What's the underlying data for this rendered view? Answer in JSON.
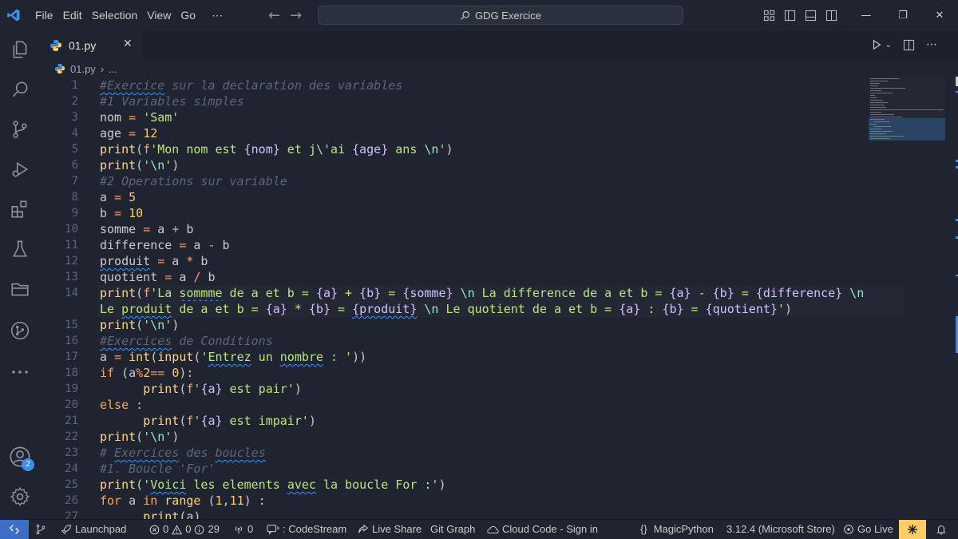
{
  "titlebar": {
    "menu": [
      "File",
      "Edit",
      "Selection",
      "View",
      "Go",
      "⋯"
    ],
    "search": "GDG Exercice"
  },
  "activity": {
    "accounts_badge": "2"
  },
  "tabs": [
    {
      "label": "01.py"
    }
  ],
  "breadcrumb": {
    "file": "01.py",
    "rest": "..."
  },
  "editor": {
    "lines": [
      {
        "n": "1",
        "tokens": [
          [
            "c",
            "#Exercice",
            "sq"
          ],
          [
            "c",
            " sur la declaration des variables"
          ]
        ]
      },
      {
        "n": "2",
        "tokens": [
          [
            "c",
            "#1 Variables simples"
          ]
        ]
      },
      {
        "n": "3",
        "tokens": [
          [
            "v",
            "nom "
          ],
          [
            "o",
            "="
          ],
          [
            "v",
            " "
          ],
          [
            "s",
            "'Sam'"
          ]
        ]
      },
      {
        "n": "4",
        "tokens": [
          [
            "v",
            "age "
          ],
          [
            "o",
            "="
          ],
          [
            "v",
            " "
          ],
          [
            "n",
            "12"
          ]
        ]
      },
      {
        "n": "5",
        "tokens": [
          [
            "f",
            "print"
          ],
          [
            "v",
            "("
          ],
          [
            "k",
            "f"
          ],
          [
            "s",
            "'Mon nom est "
          ],
          [
            "b",
            "{nom}"
          ],
          [
            "s",
            " et j"
          ],
          [
            "e",
            "\\'"
          ],
          [
            "s",
            "ai "
          ],
          [
            "b",
            "{age}"
          ],
          [
            "s",
            " ans "
          ],
          [
            "e",
            "\\n"
          ],
          [
            "s",
            "'"
          ],
          [
            "v",
            ")"
          ]
        ]
      },
      {
        "n": "6",
        "tokens": [
          [
            "f",
            "print"
          ],
          [
            "v",
            "("
          ],
          [
            "s",
            "'"
          ],
          [
            "e",
            "\\n"
          ],
          [
            "s",
            "'"
          ],
          [
            "v",
            ")"
          ]
        ]
      },
      {
        "n": "7",
        "tokens": [
          [
            "c",
            "#2 Operations sur variable"
          ]
        ]
      },
      {
        "n": "8",
        "tokens": [
          [
            "v",
            "a "
          ],
          [
            "o",
            "="
          ],
          [
            "v",
            " "
          ],
          [
            "n",
            "5"
          ]
        ]
      },
      {
        "n": "9",
        "tokens": [
          [
            "v",
            "b "
          ],
          [
            "o",
            "="
          ],
          [
            "v",
            " "
          ],
          [
            "n",
            "10"
          ]
        ]
      },
      {
        "n": "10",
        "tokens": [
          [
            "v",
            "somme "
          ],
          [
            "o",
            "="
          ],
          [
            "v",
            " a "
          ],
          [
            "o",
            "+"
          ],
          [
            "v",
            " b"
          ]
        ]
      },
      {
        "n": "11",
        "tokens": [
          [
            "v",
            "difference "
          ],
          [
            "o",
            "="
          ],
          [
            "v",
            " a "
          ],
          [
            "o",
            "-"
          ],
          [
            "v",
            " b"
          ]
        ]
      },
      {
        "n": "12",
        "tokens": [
          [
            "v",
            "produit",
            "sq"
          ],
          [
            "v",
            " "
          ],
          [
            "o",
            "="
          ],
          [
            "v",
            " a "
          ],
          [
            "o",
            "*"
          ],
          [
            "v",
            " b"
          ]
        ]
      },
      {
        "n": "13",
        "tokens": [
          [
            "v",
            "quotient "
          ],
          [
            "o",
            "="
          ],
          [
            "v",
            " a "
          ],
          [
            "o",
            "/"
          ],
          [
            "v",
            " b"
          ]
        ]
      },
      {
        "n": "14",
        "hl": true,
        "tokens": [
          [
            "f",
            "print"
          ],
          [
            "v",
            "("
          ],
          [
            "k",
            "f"
          ],
          [
            "s",
            "'La "
          ],
          [
            "s",
            "sommme",
            "sq"
          ],
          [
            "s",
            " de a et b = "
          ],
          [
            "b",
            "{a}"
          ],
          [
            "s",
            " + "
          ],
          [
            "b",
            "{b}"
          ],
          [
            "s",
            " = "
          ],
          [
            "b",
            "{somme}"
          ],
          [
            "s",
            " "
          ],
          [
            "e",
            "\\n"
          ],
          [
            "s",
            " La difference de a et b = "
          ],
          [
            "b",
            "{a}"
          ],
          [
            "s",
            " - "
          ],
          [
            "b",
            "{b}"
          ],
          [
            "s",
            " = "
          ],
          [
            "b",
            "{difference}"
          ],
          [
            "s",
            " "
          ],
          [
            "e",
            "\\n"
          ]
        ]
      },
      {
        "n": "",
        "hl": true,
        "tokens": [
          [
            "s",
            "Le "
          ],
          [
            "s",
            "produit",
            "sq"
          ],
          [
            "s",
            " de a et b = "
          ],
          [
            "b",
            "{a}"
          ],
          [
            "s",
            " * "
          ],
          [
            "b",
            "{b}"
          ],
          [
            "s",
            " = "
          ],
          [
            "b",
            "{produit}",
            "sq"
          ],
          [
            "s",
            " "
          ],
          [
            "e",
            "\\n"
          ],
          [
            "s",
            " Le quotient de a et b = "
          ],
          [
            "b",
            "{a}"
          ],
          [
            "s",
            " : "
          ],
          [
            "b",
            "{b}"
          ],
          [
            "s",
            " = "
          ],
          [
            "b",
            "{quotient}"
          ],
          [
            "s",
            "'"
          ],
          [
            "v",
            ")"
          ]
        ]
      },
      {
        "n": "15",
        "tokens": [
          [
            "f",
            "print"
          ],
          [
            "v",
            "("
          ],
          [
            "s",
            "'"
          ],
          [
            "e",
            "\\n"
          ],
          [
            "s",
            "'"
          ],
          [
            "v",
            ")"
          ]
        ]
      },
      {
        "n": "16",
        "tokens": [
          [
            "c",
            "#Exercices",
            "sq"
          ],
          [
            "c",
            " de Conditions"
          ]
        ]
      },
      {
        "n": "17",
        "tokens": [
          [
            "v",
            "a "
          ],
          [
            "o",
            "="
          ],
          [
            "v",
            " "
          ],
          [
            "f",
            "int"
          ],
          [
            "v",
            "("
          ],
          [
            "f",
            "input"
          ],
          [
            "v",
            "("
          ],
          [
            "s",
            "'"
          ],
          [
            "s",
            "Entrez",
            "sq"
          ],
          [
            "s",
            " un "
          ],
          [
            "s",
            "nombre",
            "sq"
          ],
          [
            "s",
            " : '"
          ],
          [
            "v",
            "))"
          ]
        ]
      },
      {
        "n": "18",
        "tokens": [
          [
            "k",
            "if"
          ],
          [
            "v",
            " (a"
          ],
          [
            "o",
            "%"
          ],
          [
            "n",
            "2"
          ],
          [
            "o",
            "=="
          ],
          [
            "v",
            " "
          ],
          [
            "n",
            "0"
          ],
          [
            "v",
            "):"
          ]
        ]
      },
      {
        "n": "19",
        "tokens": [
          [
            "v",
            "      "
          ],
          [
            "f",
            "print"
          ],
          [
            "v",
            "("
          ],
          [
            "k",
            "f"
          ],
          [
            "s",
            "'"
          ],
          [
            "b",
            "{a}"
          ],
          [
            "s",
            " est pair'"
          ],
          [
            "v",
            ")"
          ]
        ]
      },
      {
        "n": "20",
        "tokens": [
          [
            "k",
            "else"
          ],
          [
            "v",
            " :"
          ]
        ]
      },
      {
        "n": "21",
        "tokens": [
          [
            "v",
            "      "
          ],
          [
            "f",
            "print"
          ],
          [
            "v",
            "("
          ],
          [
            "k",
            "f"
          ],
          [
            "s",
            "'"
          ],
          [
            "b",
            "{a}"
          ],
          [
            "s",
            " est impair'"
          ],
          [
            "v",
            ")"
          ]
        ]
      },
      {
        "n": "22",
        "tokens": [
          [
            "f",
            "print"
          ],
          [
            "v",
            "("
          ],
          [
            "s",
            "'"
          ],
          [
            "e",
            "\\n"
          ],
          [
            "s",
            "'"
          ],
          [
            "v",
            ")"
          ]
        ]
      },
      {
        "n": "23",
        "tokens": [
          [
            "c",
            "# "
          ],
          [
            "c",
            "Exercices",
            "sq"
          ],
          [
            "c",
            " des "
          ],
          [
            "c",
            "boucles",
            "sq"
          ]
        ]
      },
      {
        "n": "24",
        "tokens": [
          [
            "c",
            "#1. Boucle 'For'"
          ]
        ]
      },
      {
        "n": "25",
        "tokens": [
          [
            "f",
            "print"
          ],
          [
            "v",
            "("
          ],
          [
            "s",
            "'"
          ],
          [
            "s",
            "Voici",
            "sq"
          ],
          [
            "s",
            " les elements "
          ],
          [
            "s",
            "avec",
            "sq"
          ],
          [
            "s",
            " la boucle For :'"
          ],
          [
            "v",
            ")"
          ]
        ]
      },
      {
        "n": "26",
        "tokens": [
          [
            "k",
            "for"
          ],
          [
            "v",
            " a "
          ],
          [
            "k",
            "in"
          ],
          [
            "v",
            " "
          ],
          [
            "f",
            "range"
          ],
          [
            "v",
            " ("
          ],
          [
            "n",
            "1"
          ],
          [
            "v",
            ","
          ],
          [
            "n",
            "11"
          ],
          [
            "v",
            ") :"
          ]
        ]
      },
      {
        "n": "27",
        "tokens": [
          [
            "v",
            "      "
          ],
          [
            "f",
            "print"
          ],
          [
            "v",
            "(a)"
          ]
        ]
      }
    ]
  },
  "statusbar": {
    "launchpad": "Launchpad",
    "errors": "0",
    "warnings": "0",
    "infos": "29",
    "ports": "0",
    "codestream": ": CodeStream",
    "liveshare": "Live Share",
    "gitgraph": "Git Graph",
    "cloudcode": "Cloud Code - Sign in",
    "language": "MagicPython",
    "interpreter": "3.12.4 (Microsoft Store)",
    "golive": "Go Live"
  },
  "colors": {
    "background": "#1f2430",
    "comment": "#5c6773",
    "string": "#bae67e",
    "number": "#ffcc66",
    "function": "#ffd580",
    "keyword": "#ffa759",
    "brace": "#d4bfff",
    "accent": "#3b6fc4"
  }
}
